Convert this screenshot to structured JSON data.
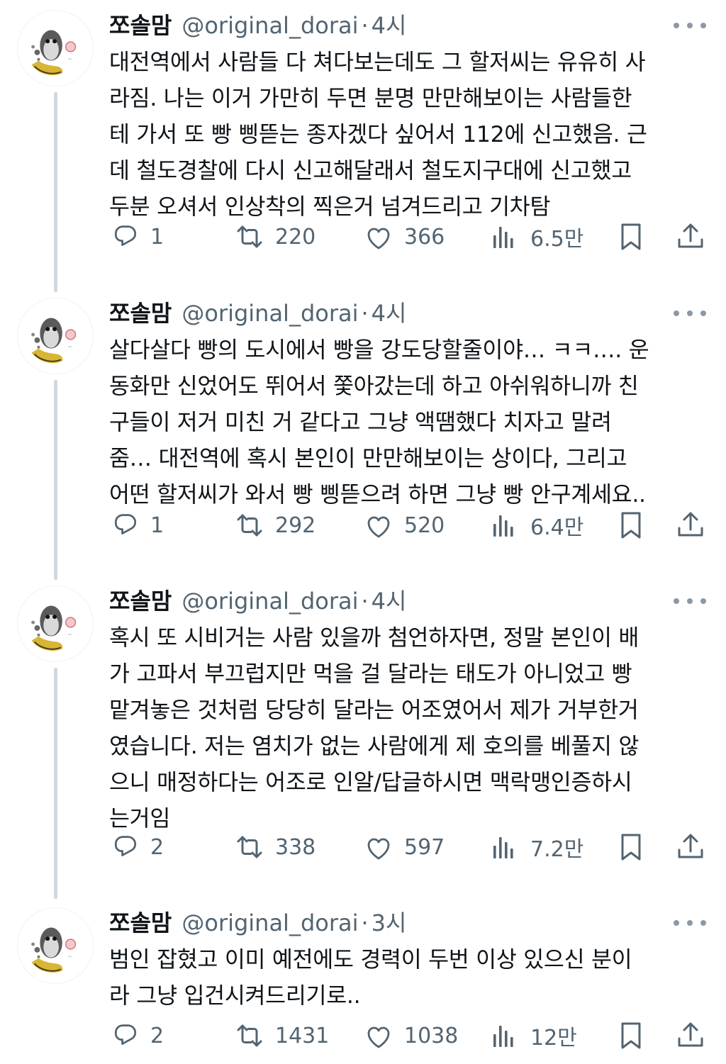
{
  "tweets": [
    {
      "name": "쪼솔맘",
      "handle": "@original_dorai",
      "dot": "·",
      "time": "4시",
      "text": "대전역에서 사람들 다 쳐다보는데도 그 할저씨는 유유히 사\n라짐. 나는 이거 가만히 두면 분명 만만해보이는 사람들한\n테 가서 또 빵 삥뜯는 종자겠다 싶어서 112에 신고했음. 근\n데 철도경찰에 다시 신고해달래서 철도지구대에 신고했고\n두분 오셔서 인상착의 찍은거 넘겨드리고 기차탐",
      "replies": "1",
      "retweets": "220",
      "likes": "366",
      "views": "6.5만"
    },
    {
      "name": "쪼솔맘",
      "handle": "@original_dorai",
      "dot": "·",
      "time": "4시",
      "text": "살다살다 빵의 도시에서 빵을 강도당할줄이야… ㅋㅋ…. 운\n동화만 신었어도 뛰어서 쫓아갔는데 하고 아쉬워하니까 친\n구들이 저거 미친 거 같다고 그냥 액땜했다 치자고 말려\n줌… 대전역에 혹시 본인이 만만해보이는 상이다, 그리고\n어떤 할저씨가 와서 빵 삥뜯으려 하면 그냥 빵 안구계세요..",
      "replies": "1",
      "retweets": "292",
      "likes": "520",
      "views": "6.4만"
    },
    {
      "name": "쪼솔맘",
      "handle": "@original_dorai",
      "dot": "·",
      "time": "4시",
      "text": "혹시 또 시비거는 사람 있을까 첨언하자면, 정말 본인이 배\n가 고파서 부끄럽지만 먹을 걸 달라는 태도가 아니었고 빵\n맡겨놓은 것처럼 당당히 달라는 어조였어서 제가 거부한거\n였습니다. 저는 염치가 없는 사람에게 제 호의를 베풀지 않\n으니 매정하다는 어조로 인알/답글하시면 맥락맹인증하시\n는거임",
      "replies": "2",
      "retweets": "338",
      "likes": "597",
      "views": "7.2만"
    },
    {
      "name": "쪼솔맘",
      "handle": "@original_dorai",
      "dot": "·",
      "time": "3시",
      "text": "범인 잡혔고 이미 예전에도 경력이 두번 이상 있으신 분이\n라 그냥 입건시켜드리기로..",
      "replies": "2",
      "retweets": "1431",
      "likes": "1038",
      "views": "12만"
    }
  ],
  "icons": {
    "reply": "reply-icon",
    "retweet": "retweet-icon",
    "like": "heart-icon",
    "views": "views-icon",
    "bookmark": "bookmark-icon",
    "share": "share-icon",
    "more": "more-icon"
  },
  "colors": {
    "text": "#0f1419",
    "secondary": "#536471",
    "thread_line": "#cfd9de"
  }
}
